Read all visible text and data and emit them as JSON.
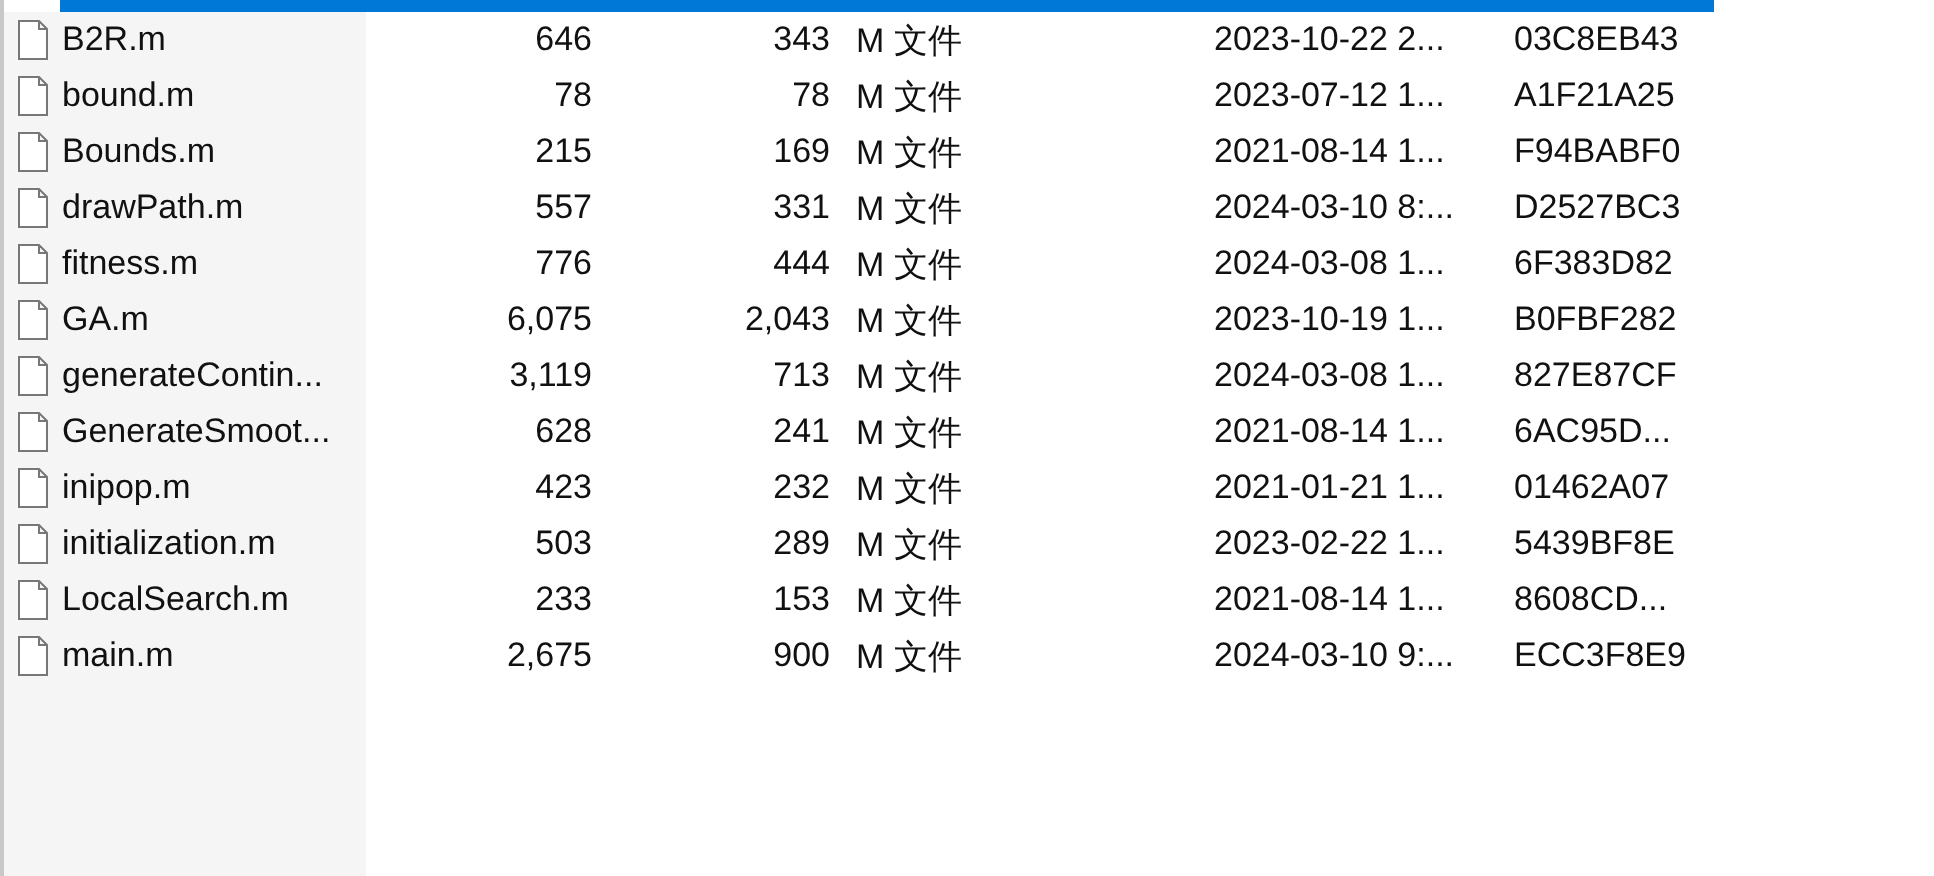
{
  "top_row": {
    "selected": true
  },
  "rows": [
    {
      "name": "B2R.m",
      "size": "646",
      "packed": "343",
      "type": "M 文件",
      "modified": "2023-10-22 2...",
      "crc": "03C8EB43"
    },
    {
      "name": "bound.m",
      "size": "78",
      "packed": "78",
      "type": "M 文件",
      "modified": "2023-07-12 1...",
      "crc": "A1F21A25"
    },
    {
      "name": "Bounds.m",
      "size": "215",
      "packed": "169",
      "type": "M 文件",
      "modified": "2021-08-14 1...",
      "crc": "F94BABF0"
    },
    {
      "name": "drawPath.m",
      "size": "557",
      "packed": "331",
      "type": "M 文件",
      "modified": "2024-03-10 8:...",
      "crc": "D2527BC3"
    },
    {
      "name": "fitness.m",
      "size": "776",
      "packed": "444",
      "type": "M 文件",
      "modified": "2024-03-08 1...",
      "crc": "6F383D82"
    },
    {
      "name": "GA.m",
      "size": "6,075",
      "packed": "2,043",
      "type": "M 文件",
      "modified": "2023-10-19 1...",
      "crc": "B0FBF282"
    },
    {
      "name": "generateContin...",
      "size": "3,119",
      "packed": "713",
      "type": "M 文件",
      "modified": "2024-03-08 1...",
      "crc": "827E87CF"
    },
    {
      "name": "GenerateSmoot...",
      "size": "628",
      "packed": "241",
      "type": "M 文件",
      "modified": "2021-08-14 1...",
      "crc": "6AC95D..."
    },
    {
      "name": "inipop.m",
      "size": "423",
      "packed": "232",
      "type": "M 文件",
      "modified": "2021-01-21 1...",
      "crc": "01462A07"
    },
    {
      "name": "initialization.m",
      "size": "503",
      "packed": "289",
      "type": "M 文件",
      "modified": "2023-02-22 1...",
      "crc": "5439BF8E"
    },
    {
      "name": "LocalSearch.m",
      "size": "233",
      "packed": "153",
      "type": "M 文件",
      "modified": "2021-08-14 1...",
      "crc": "8608CD..."
    },
    {
      "name": "main.m",
      "size": "2,675",
      "packed": "900",
      "type": "M 文件",
      "modified": "2024-03-10 9:...",
      "crc": "ECC3F8E9"
    }
  ]
}
